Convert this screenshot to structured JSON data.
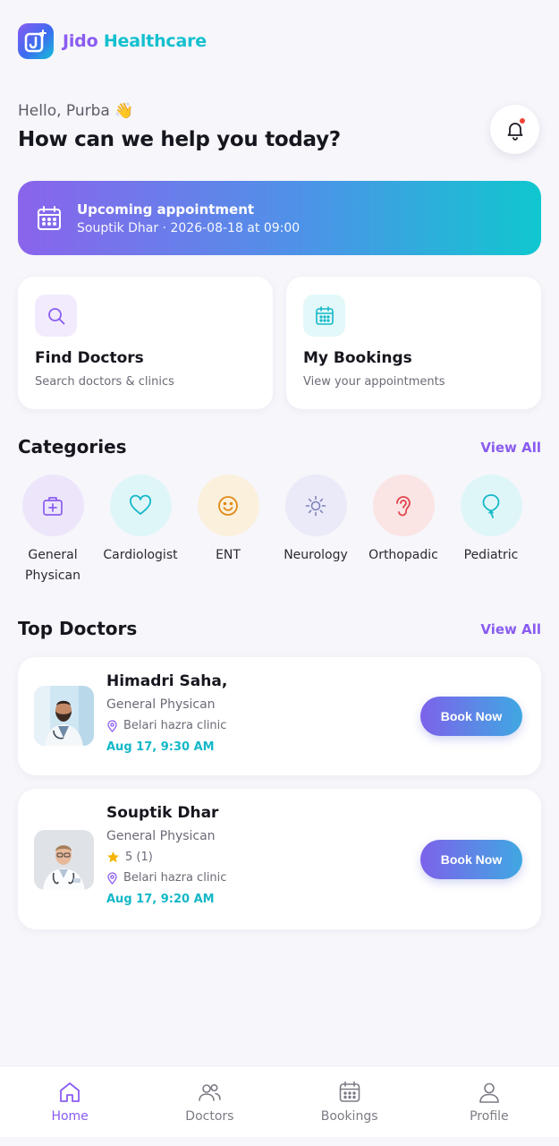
{
  "app": {
    "title_part1": "Jido",
    "title_part2": "Healthcare"
  },
  "greeting": "Hello, Purba 👋",
  "headline": "How can we help you today?",
  "appointment": {
    "title": "Upcoming appointment",
    "subtitle": "Souptik Dhar · 2026-08-18 at 09:00"
  },
  "quick_actions": [
    {
      "title": "Find Doctors",
      "subtitle": "Search doctors & clinics",
      "icon": "search-icon"
    },
    {
      "title": "My Bookings",
      "subtitle": "View your appointments",
      "icon": "calendar-icon"
    }
  ],
  "categories": {
    "title": "Categories",
    "view_all": "View All",
    "items": [
      {
        "label": "General Physican",
        "icon": "first-aid-kit-icon"
      },
      {
        "label": "Cardiologist",
        "icon": "heart-icon"
      },
      {
        "label": "ENT",
        "icon": "smiley-icon"
      },
      {
        "label": "Neurology",
        "icon": "sun-icon"
      },
      {
        "label": "Orthopadic",
        "icon": "ear-icon"
      },
      {
        "label": "Pediatric",
        "icon": "balloon-icon"
      }
    ]
  },
  "top_doctors": {
    "title": "Top Doctors",
    "view_all": "View All",
    "items": [
      {
        "name": "Himadri Saha,",
        "specialty": "General Physican",
        "location": "Belari hazra clinic",
        "time": "Aug 17, 9:30 AM",
        "book_label": "Book Now"
      },
      {
        "name": "Souptik Dhar",
        "specialty": "General Physican",
        "rating": "5 (1)",
        "location": "Belari hazra clinic",
        "time": "Aug 17, 9:20 AM",
        "book_label": "Book Now"
      }
    ]
  },
  "tabs": [
    {
      "label": "Home",
      "icon": "home-icon",
      "active": true
    },
    {
      "label": "Doctors",
      "icon": "users-icon",
      "active": false
    },
    {
      "label": "Bookings",
      "icon": "calendar-icon",
      "active": false
    },
    {
      "label": "Profile",
      "icon": "user-icon",
      "active": false
    }
  ],
  "colors": {
    "accent": "#8a5cf0",
    "teal": "#14c0cf",
    "background": "#f6f6fb"
  }
}
